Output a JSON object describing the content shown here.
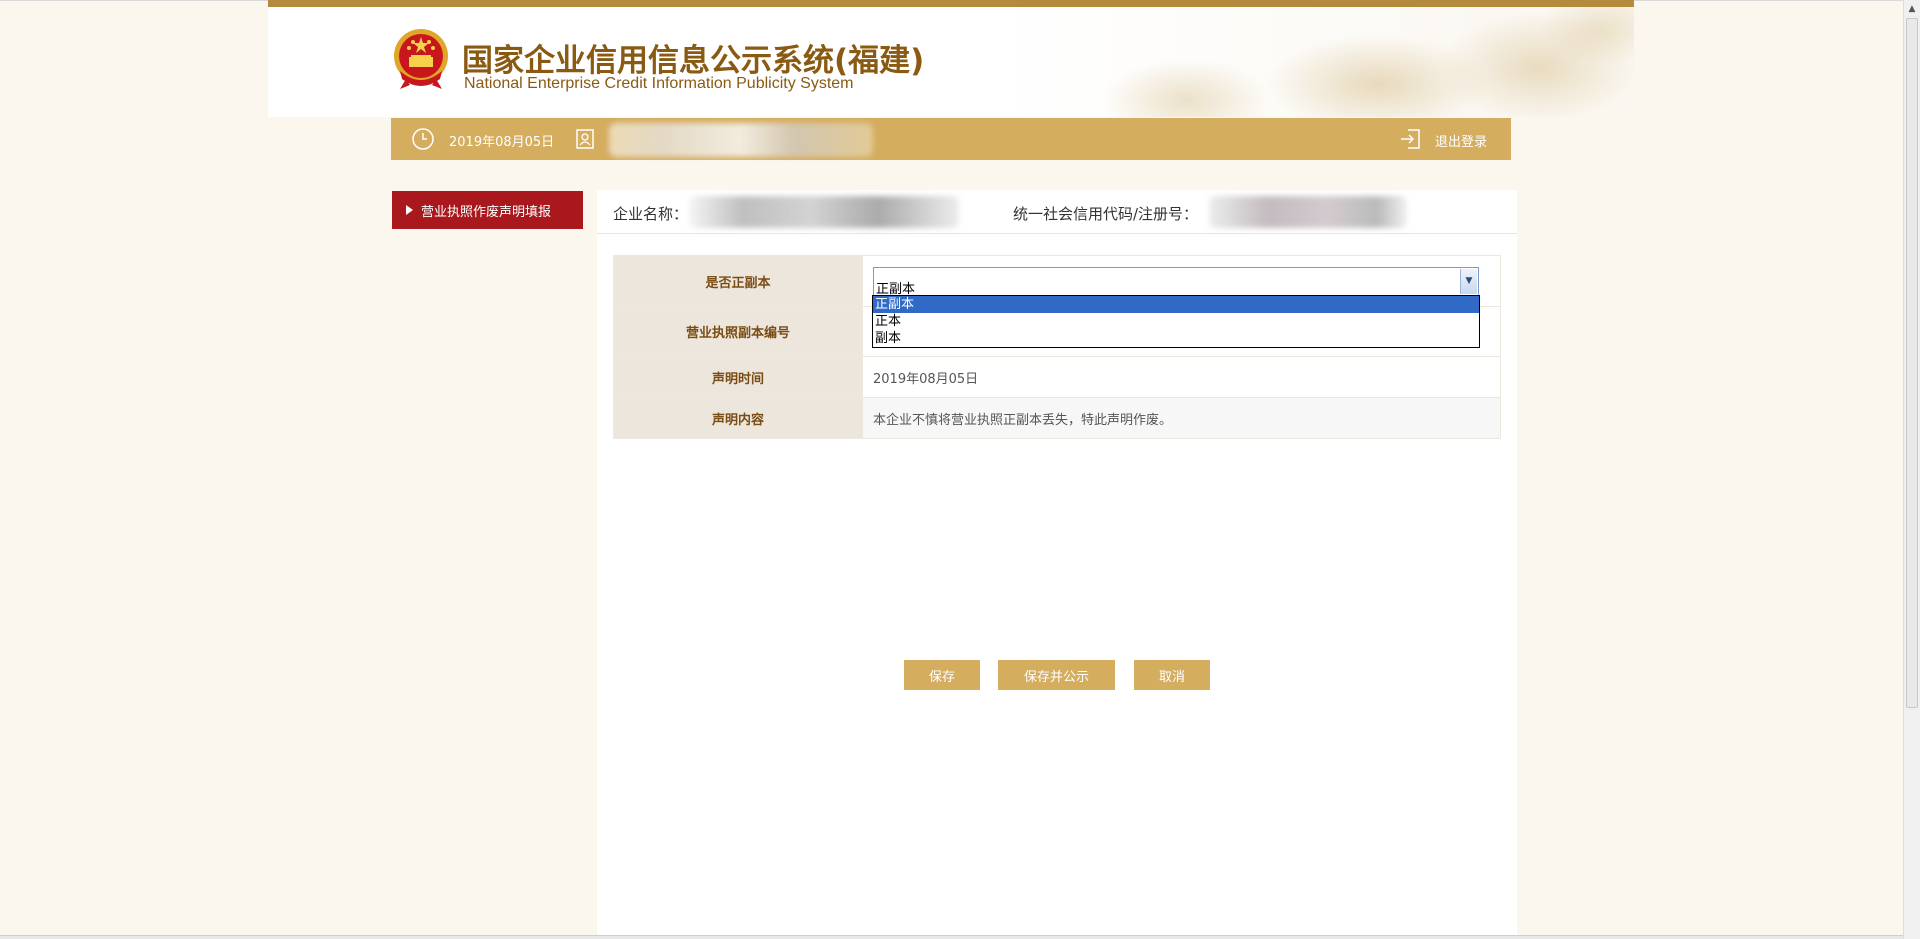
{
  "header": {
    "title": "国家企业信用信息公示系统(福建)",
    "subtitle": "National Enterprise Credit Information Publicity System"
  },
  "topbar": {
    "date": "2019年08月05日",
    "logout_label": "退出登录"
  },
  "sidebar": {
    "items": [
      {
        "label": "营业执照作废声明填报"
      }
    ]
  },
  "company": {
    "name_label": "企业名称：",
    "credit_code_label": "统一社会信用代码/注册号："
  },
  "form": {
    "rows": [
      {
        "label": "是否正副本",
        "value": "正副本"
      },
      {
        "label": "营业执照副本编号",
        "value": ""
      },
      {
        "label": "声明时间",
        "value": "2019年08月05日"
      },
      {
        "label": "声明内容",
        "value": "本企业不慎将营业执照正副本丢失，特此声明作废。"
      }
    ],
    "dropdown_options": [
      "正副本",
      "正本",
      "副本"
    ],
    "dropdown_selected": "正副本"
  },
  "buttons": {
    "save": "保存",
    "save_publish": "保存并公示",
    "cancel": "取消"
  },
  "colors": {
    "gold": "#d4ad5f",
    "header_brown": "#8a5a12",
    "sidebar_red": "#a8181c",
    "statement_red": "#e60000",
    "selected_blue": "#3169c6"
  }
}
